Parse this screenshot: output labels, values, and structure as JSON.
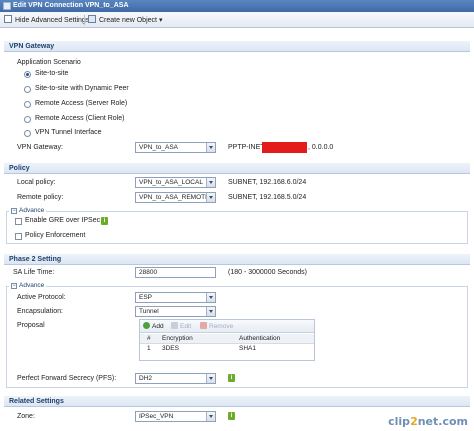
{
  "window": {
    "title": "Edit VPN Connection VPN_to_ASA"
  },
  "toolbar": {
    "hide_advanced": "Hide Advanced Settings",
    "create_new": "Create new Object",
    "create_new_arrow": "▾"
  },
  "vpn_gateway": {
    "section_title": "VPN Gateway",
    "application_scenario_label": "Application Scenario",
    "scenarios": [
      {
        "label": "Site-to-site",
        "selected": true
      },
      {
        "label": "Site-to-site with Dynamic Peer",
        "selected": false
      },
      {
        "label": "Remote Access (Server Role)",
        "selected": false
      },
      {
        "label": "Remote Access (Client Role)",
        "selected": false
      },
      {
        "label": "VPN Tunnel Interface",
        "selected": false
      }
    ],
    "gateway_label": "VPN Gateway:",
    "gateway_value": "VPN_to_ASA",
    "gateway_info_prefix": "PPTP-INET",
    "gateway_info_suffix": ", 0.0.0.0"
  },
  "policy": {
    "section_title": "Policy",
    "local_label": "Local policy:",
    "local_value": "VPN_to_ASA_LOCAL",
    "local_subnet": "SUBNET, 192.168.6.0/24",
    "remote_label": "Remote policy:",
    "remote_value": "VPN_to_ASA_REMOTE",
    "remote_subnet": "SUBNET, 192.168.5.0/24",
    "advance_title": "Advance",
    "enable_gre": "Enable GRE over IPSec",
    "policy_enforcement": "Policy Enforcement"
  },
  "phase2": {
    "section_title": "Phase 2 Setting",
    "sa_life_label": "SA Life Time:",
    "sa_life_value": "28800",
    "sa_life_range": "(180 - 3000000 Seconds)",
    "advance_title": "Advance",
    "active_protocol_label": "Active Protocol:",
    "active_protocol_value": "ESP",
    "encapsulation_label": "Encapsulation:",
    "encapsulation_value": "Tunnel",
    "proposal_label": "Proposal",
    "proposal_toolbar": {
      "add": "Add",
      "edit": "Edit",
      "remove": "Remove"
    },
    "proposal_columns": [
      "#",
      "Encryption",
      "Authentication"
    ],
    "proposal_rows": [
      {
        "num": "1",
        "encryption": "3DES",
        "authentication": "SHA1"
      }
    ],
    "pfs_label": "Perfect Forward Secrecy (PFS):",
    "pfs_value": "DH2"
  },
  "related": {
    "section_title": "Related Settings",
    "zone_label": "Zone:",
    "zone_value": "IPSec_VPN"
  },
  "watermark": {
    "text_a": "clip",
    "text_b": "2",
    "text_c": "net.com"
  },
  "colors": {
    "accent": "#3f6aa6",
    "section_text": "#1f3f6e",
    "info_green": "#6cab2b",
    "redaction": "#e41b1b"
  },
  "icons": {
    "window": "window-icon",
    "hide_advanced": "settings-icon",
    "create_new": "new-object-icon",
    "info": "info-icon",
    "add": "add-icon",
    "edit": "edit-icon",
    "remove": "remove-icon"
  }
}
